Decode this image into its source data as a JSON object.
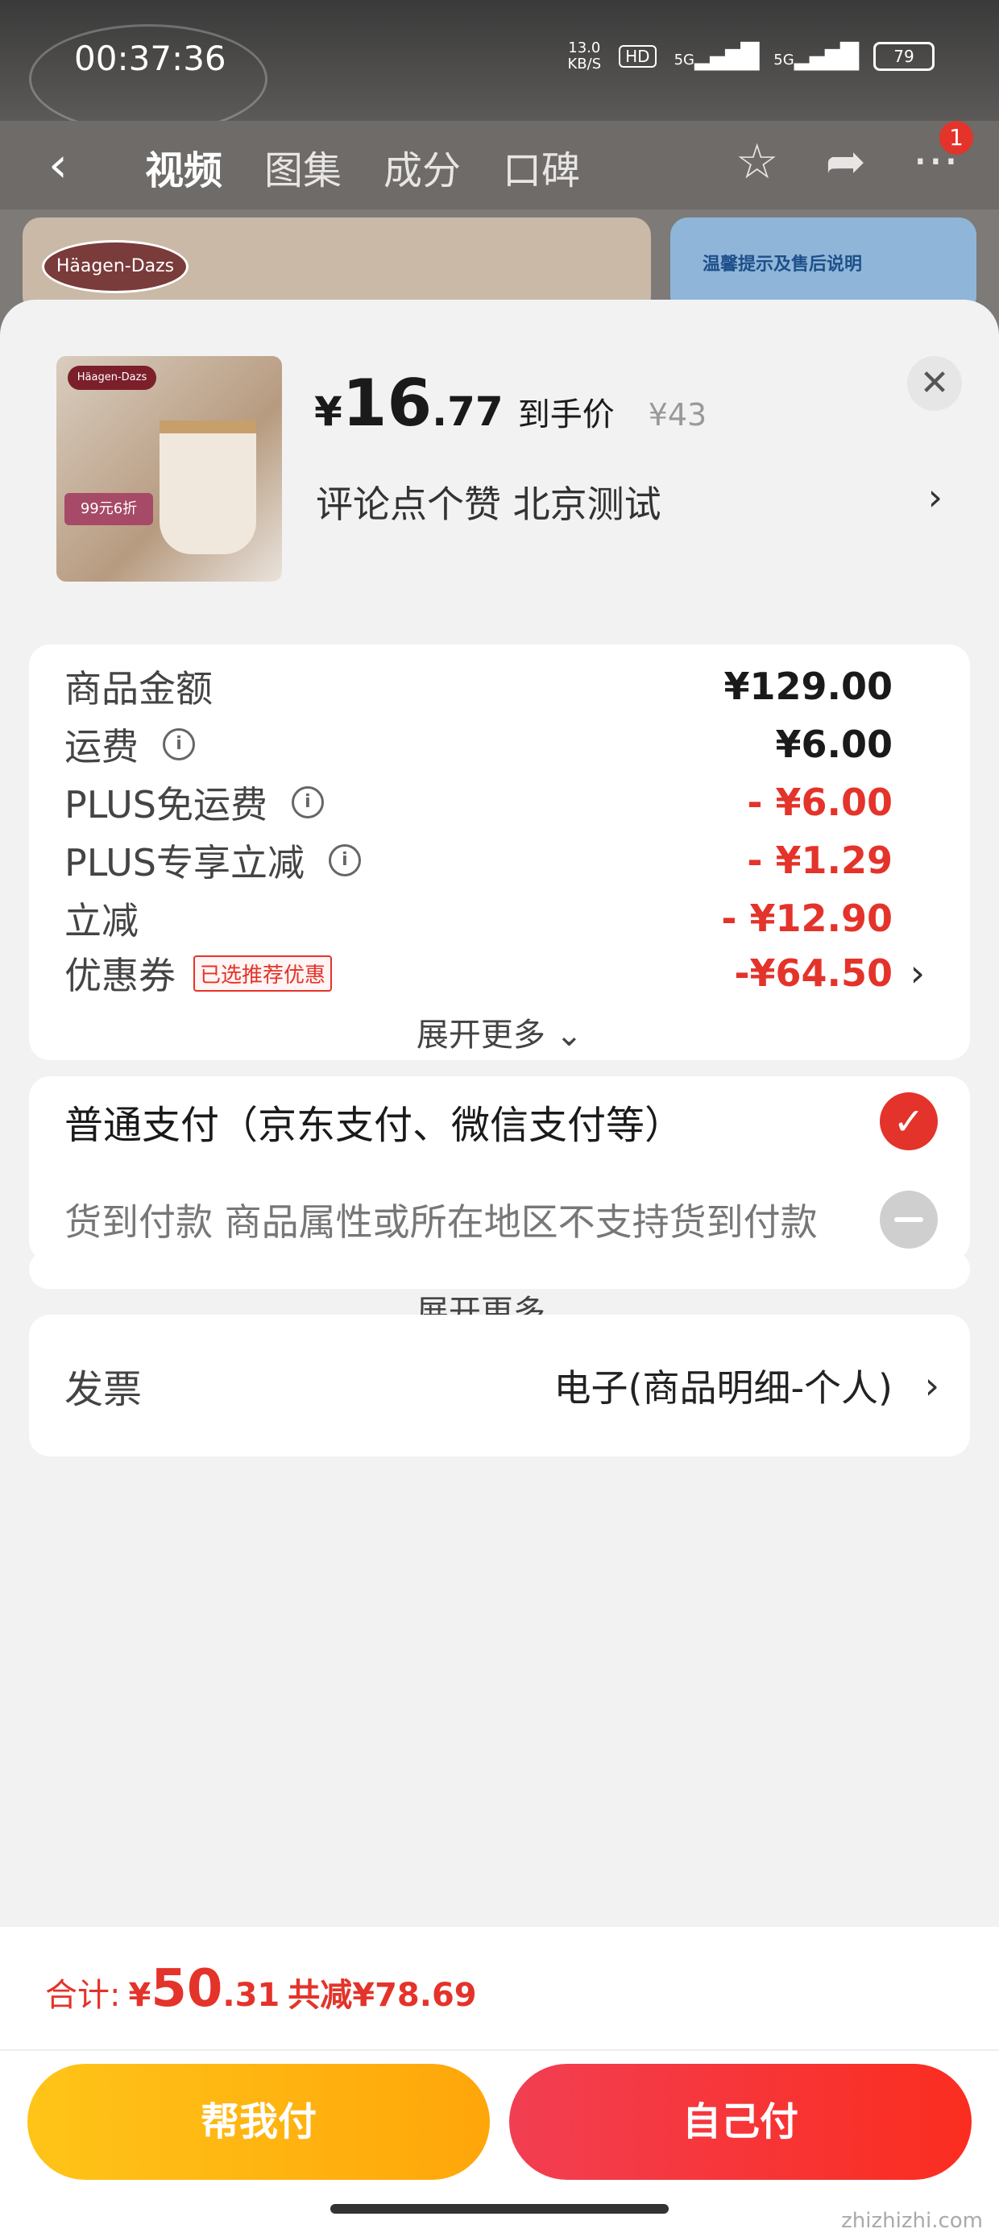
{
  "status_bar": {
    "time": "00:37:36",
    "net_speed": "13.0",
    "net_unit": "KB/S",
    "hd": "HD",
    "sig1": "5G",
    "sig2": "5G",
    "battery": "79"
  },
  "nav": {
    "back_icon": "back-chevron-icon",
    "tabs": [
      {
        "label": "视频",
        "active": true
      },
      {
        "label": "图集",
        "active": false
      },
      {
        "label": "成分",
        "active": false
      },
      {
        "label": "口碑",
        "active": false
      }
    ],
    "badge_count": "1"
  },
  "banner": {
    "brand": "Häagen-Dazs",
    "notice_title": "温馨提示及售后说明"
  },
  "product": {
    "thumb_logo": "Häagen-Dazs",
    "thumb_tag": "99元6折",
    "price_symbol": "¥",
    "price_int": "16",
    "price_dec": ".77",
    "price_label": "到手价",
    "original_price": "¥43",
    "description": "评论点个赞  北京测试"
  },
  "breakdown": {
    "rows": [
      {
        "label": "商品金额",
        "value": "¥129.00"
      },
      {
        "label": "运费",
        "value": "¥6.00"
      },
      {
        "label": "PLUS免运费",
        "value": "- ¥6.00"
      },
      {
        "label": "PLUS专享立减",
        "value": "- ¥1.29"
      },
      {
        "label": "立减",
        "value": "- ¥12.90"
      },
      {
        "label": "优惠券",
        "value": "-¥64.50",
        "tag": "已选推荐优惠"
      }
    ],
    "expand_label": "展开更多"
  },
  "payment": {
    "options": [
      {
        "label": "普通支付（京东支付、微信支付等）",
        "selected": true
      },
      {
        "label": "货到付款 商品属性或所在地区不支持货到付款",
        "disabled": true
      }
    ],
    "expand_label": "展开更多"
  },
  "invoice": {
    "label": "发票",
    "value": "电子(商品明细-个人)"
  },
  "footer": {
    "total_label": "合计:",
    "total_symbol": "¥",
    "total_int": "50",
    "total_dec": ".31",
    "total_saved": "共减¥78.69",
    "help_pay_label": "帮我付",
    "self_pay_label": "自己付",
    "watermark": "zhizhizhi.com"
  },
  "colors": {
    "accent_red": "#e4332a",
    "help_btn": "#ffb30f",
    "self_btn": "#f5303b"
  }
}
